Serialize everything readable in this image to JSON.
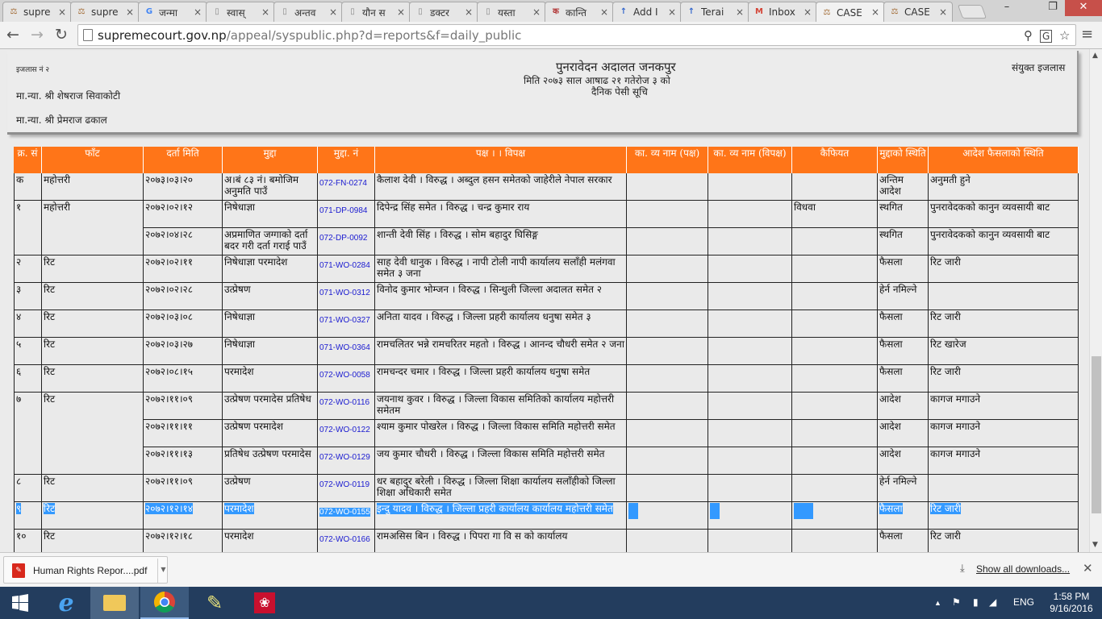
{
  "browser": {
    "tabs": [
      {
        "label": "supre",
        "icon": "scales-icon",
        "color": "#a06830"
      },
      {
        "label": "supre",
        "icon": "scales-icon",
        "color": "#a06830"
      },
      {
        "label": "जन्मा",
        "icon": "google-icon",
        "color": "#4285f4"
      },
      {
        "label": "स्वास्",
        "icon": "page-icon",
        "color": "#888888"
      },
      {
        "label": "अन्तव",
        "icon": "page-icon",
        "color": "#888888"
      },
      {
        "label": "यौन स",
        "icon": "page-icon",
        "color": "#888888"
      },
      {
        "label": "डक्टर",
        "icon": "page-icon",
        "color": "#888888"
      },
      {
        "label": "यस्ता",
        "icon": "page-icon",
        "color": "#888888"
      },
      {
        "label": "कान्ति",
        "icon": "site-logo-icon",
        "color": "#b03030"
      },
      {
        "label": "Add I",
        "icon": "upload-icon",
        "color": "#3366cc"
      },
      {
        "label": "Terai",
        "icon": "upload-icon",
        "color": "#3366cc"
      },
      {
        "label": "Inbox",
        "icon": "gmail-icon",
        "color": "#d44638"
      },
      {
        "label": "CASE",
        "icon": "scales-icon",
        "color": "#a06830",
        "active": true
      },
      {
        "label": "CASE",
        "icon": "scales-icon",
        "color": "#a06830"
      }
    ],
    "url_host": "supremecourt.gov.np",
    "url_path": "/appeal/syspublic.php?d=reports&f=daily_public"
  },
  "header": {
    "court_name": "पुनरावेदन अदालत जनकपुर",
    "date_line": "मिति  २०७३ साल आषाढ २१ गतेरोज ३ को",
    "list_title": "दैनिक पेसी सूचि",
    "bench_no": "इजलास नं २",
    "bench_type": "संयुक्त इजलास",
    "judge_1": "मा.न्या. श्री शेषराज सिवाकोटी",
    "judge_2": "मा.न्या. श्री प्रेमराज ढकाल"
  },
  "table": {
    "columns": [
      "क्र. सं",
      "फाँट",
      "दर्ता मिति",
      "मुद्दा",
      "मुद्दा. नं",
      "पक्ष । । विपक्ष",
      "का. व्य नाम (पक्ष)",
      "का. व्य नाम (विपक्ष)",
      "कैफियत",
      "मुद्दाको स्थिति",
      "आदेश फैसलाको स्थिति"
    ],
    "rows": [
      {
        "sn": "क",
        "faat": "महोत्तरी",
        "date": "२०७३।०३।२०",
        "case": "अ।बं ८३ नं। बमोजिम अनुमति पाउँ",
        "no": "072-FN-0274",
        "party": "कैलाश देवी । विरुद्ध । अब्दुल हसन समेतको जाहेरीले नेपाल सरकार",
        "remark": "",
        "status": "अन्तिम आदेश",
        "order": "अनुमती हुने"
      },
      {
        "sn": "१",
        "faat": "महोत्तरी",
        "date": "२०७२।०२।१२",
        "case": "निषेधाज्ञा",
        "no": "071-DP-0984",
        "party": "दिपेन्द्र सिंह समेत । विरुद्ध । चन्द्र कुमार राय",
        "remark": "विधवा",
        "status": "स्थगित",
        "order": "पुनरावेदकको कानुन व्यवसायी बाट"
      },
      {
        "sn": "",
        "faat": "",
        "date": "२०७२।०४।२८",
        "case": "अप्रमाणित जग्गाको दर्ता बदर गरी दर्ता गराई पाउँ",
        "no": "072-DP-0092",
        "party": "शान्ती देवी सिंह । विरुद्ध । सोम बहादुर घिसिङ्ग",
        "remark": "",
        "status": "स्थगित",
        "order": "पुनरावेदकको कानुन व्यवसायी बाट"
      },
      {
        "sn": "२",
        "faat": "रिट",
        "date": "२०७२।०२।११",
        "case": "निषेधाज्ञा परमादेश",
        "no": "071-WO-0284",
        "party": "साह देवी धानुक । विरुद्ध । नापी टोली नापी कार्यालय सलाँही मलंगवा समेत ३ जना",
        "remark": "",
        "status": "फैसला",
        "order": "रिट जारी"
      },
      {
        "sn": "३",
        "faat": "रिट",
        "date": "२०७२।०२।२८",
        "case": "उत्प्रेषण",
        "no": "071-WO-0312",
        "party": "विनोद कुमार भोम्जन । विरुद्ध । सिन्धुली जिल्ला अदालत समेत २",
        "remark": "",
        "status": "हेर्न नमिल्ने",
        "order": ""
      },
      {
        "sn": "४",
        "faat": "रिट",
        "date": "२०७२।०३।०८",
        "case": "निषेधाज्ञा",
        "no": "071-WO-0327",
        "party": "अनिता यादव । विरुद्ध । जिल्ला प्रहरी कार्यालय धनुषा समेत ३",
        "remark": "",
        "status": "फैसला",
        "order": "रिट जारी"
      },
      {
        "sn": "५",
        "faat": "रिट",
        "date": "२०७२।०३।२७",
        "case": "निषेधाज्ञा",
        "no": "071-WO-0364",
        "party": "रामचलितर भन्ने रामचरितर महतो । विरुद्ध । आनन्द चौधरी समेत २ जना",
        "remark": "",
        "status": "फैसला",
        "order": "रिट खारेज"
      },
      {
        "sn": "६",
        "faat": "रिट",
        "date": "२०७२।०८।१५",
        "case": "परमादेश",
        "no": "072-WO-0058",
        "party": "रामचन्दर चमार । विरुद्ध । जिल्ला प्रहरी कार्यालय धनुषा समेत",
        "remark": "",
        "status": "फैसला",
        "order": "रिट जारी"
      },
      {
        "sn": "७",
        "faat": "रिट",
        "date": "२०७२।११।०९",
        "case": "उत्प्रेषण परमादेस प्रतिषेध",
        "no": "072-WO-0116",
        "party": "जयनाथ कुवर । विरुद्ध । जिल्ला विकास समितिको कार्यालय महोत्तरी समेतम",
        "remark": "",
        "status": "आदेश",
        "order": "कागज मगाउने"
      },
      {
        "sn": "",
        "faat": "",
        "date": "२०७२।११।११",
        "case": "उत्प्रेषण परमादेश",
        "no": "072-WO-0122",
        "party": "श्याम कुमार पोखरेल । विरुद्ध । जिल्ला विकास समिति महोत्तरी समेत",
        "remark": "",
        "status": "आदेश",
        "order": "कागज मगाउने"
      },
      {
        "sn": "",
        "faat": "",
        "date": "२०७२।११।१३",
        "case": "प्रतिषेध उत्प्रेषण परमादेस",
        "no": "072-WO-0129",
        "party": "जय कुमार चौधरी । विरुद्ध । जिल्ला विकास समिति महोत्तरी समेत",
        "remark": "",
        "status": "आदेश",
        "order": "कागज मगाउने"
      },
      {
        "sn": "८",
        "faat": "रिट",
        "date": "२०७२।११।०९",
        "case": "उत्प्रेषण",
        "no": "072-WO-0119",
        "party": "धर बहादुर बरेली । विरुद्ध । जिल्ला शिक्षा कार्यालय सलाँहीको जिल्ला शिक्षा अधिकारी समेत",
        "remark": "",
        "status": "हेर्न नमिल्ने",
        "order": ""
      },
      {
        "sn": "९",
        "faat": "रिट",
        "date": "२०७२।१२।१४",
        "case": "परमादेश",
        "no": "072-WO-0155",
        "party": "इन्दु यादव । विरुद्ध । जिल्ला प्रहरी कार्यालय कार्यालय महोत्तरी समेत",
        "remark": "",
        "status": "फैसला",
        "order": "रिट जारी",
        "selected": true
      },
      {
        "sn": "१०",
        "faat": "रिट",
        "date": "२०७२।१२।१८",
        "case": "परमादेश",
        "no": "072-WO-0166",
        "party": "रामअसिस बिन । विरुद्ध । पिपरा गा वि स को कार्यालय",
        "remark": "",
        "status": "फैसला",
        "order": "रिट जारी"
      }
    ]
  },
  "downloads": {
    "file_name": "Human Rights Repor....pdf",
    "show_all": "Show all downloads..."
  },
  "taskbar": {
    "lang": "ENG",
    "time": "1:58 PM",
    "date": "9/16/2016"
  },
  "colors": {
    "header_orange": "#ff7518",
    "case_no_blue": "#1a1ad0",
    "selection_blue": "#3399ff",
    "taskbar": "#233d5e"
  }
}
